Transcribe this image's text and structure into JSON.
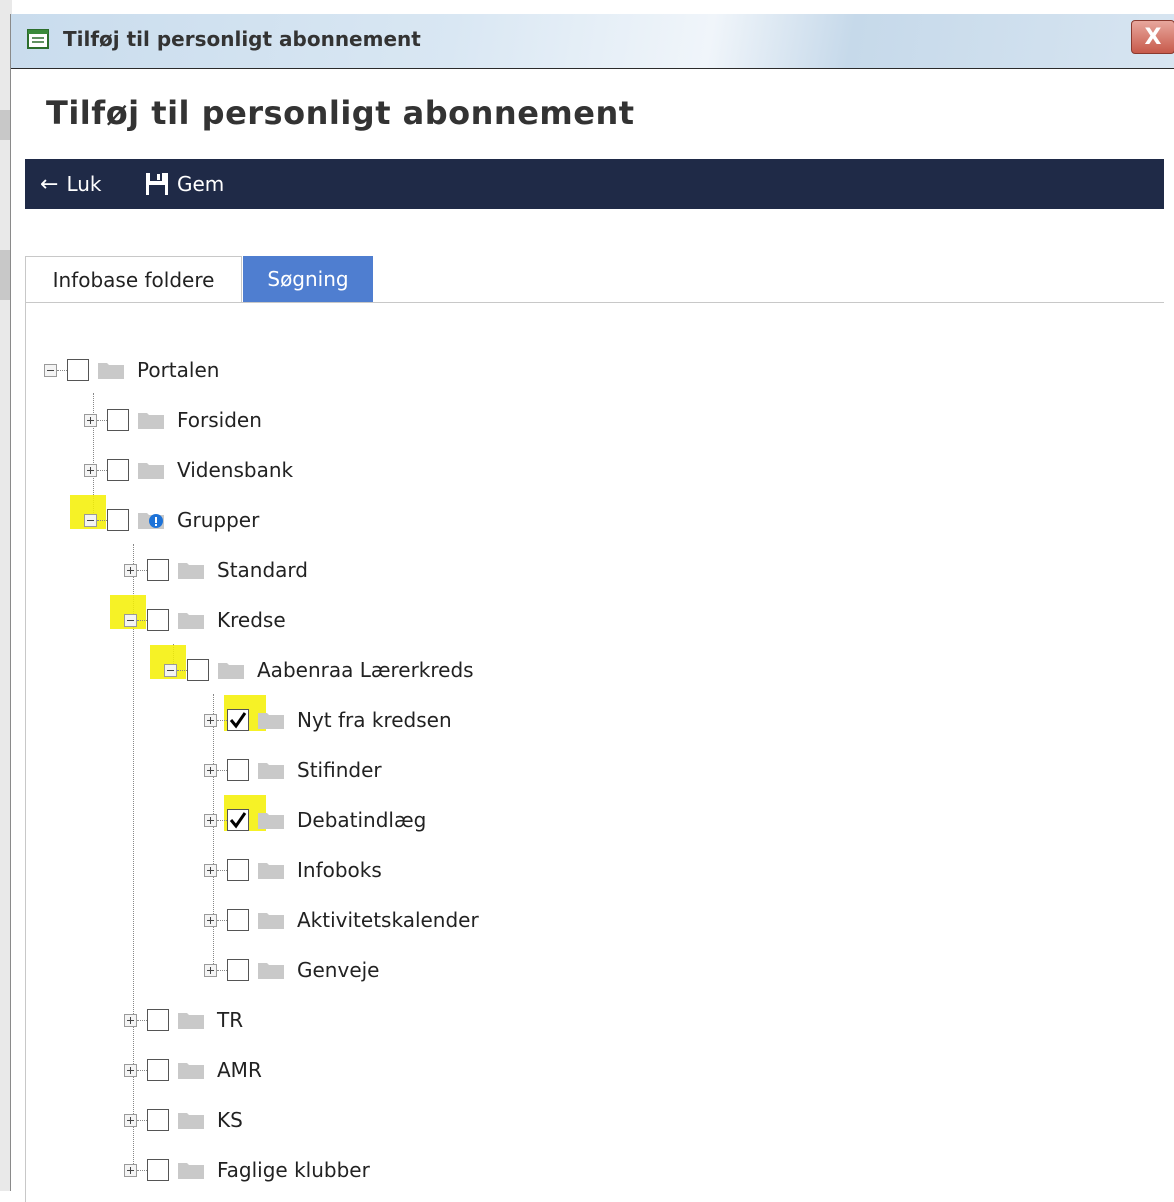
{
  "window": {
    "title": "Tilføj til personligt abonnement",
    "close_glyph": "X"
  },
  "page": {
    "title": "Tilføj til personligt abonnement"
  },
  "toolbar": {
    "close_label": "Luk",
    "close_icon": "arrow-left-icon",
    "save_label": "Gem",
    "save_icon": "floppy-disk-icon"
  },
  "tabs": [
    {
      "label": "Infobase foldere",
      "active": true
    },
    {
      "label": "Søgning",
      "active": false
    }
  ],
  "tree": {
    "items": [
      {
        "label": "Portalen",
        "level": 0,
        "expanded": true,
        "checked": false
      },
      {
        "label": "Forsiden",
        "level": 1,
        "expanded": false,
        "checked": false
      },
      {
        "label": "Vidensbank",
        "level": 1,
        "expanded": false,
        "checked": false
      },
      {
        "label": "Grupper",
        "level": 1,
        "expanded": true,
        "checked": false,
        "highlighted": true,
        "info_badge": true
      },
      {
        "label": "Standard",
        "level": 2,
        "expanded": false,
        "checked": false
      },
      {
        "label": "Kredse",
        "level": 2,
        "expanded": true,
        "checked": false,
        "highlighted": true
      },
      {
        "label": "Aabenraa Lærerkreds",
        "level": 3,
        "expanded": true,
        "checked": false,
        "highlighted": true
      },
      {
        "label": "Nyt fra kredsen",
        "level": 4,
        "expanded": false,
        "checked": true,
        "highlighted": true
      },
      {
        "label": "Stifinder",
        "level": 4,
        "expanded": false,
        "checked": false
      },
      {
        "label": "Debatindlæg",
        "level": 4,
        "expanded": false,
        "checked": true,
        "highlighted": true
      },
      {
        "label": "Infoboks",
        "level": 4,
        "expanded": false,
        "checked": false
      },
      {
        "label": "Aktivitetskalender",
        "level": 4,
        "expanded": false,
        "checked": false
      },
      {
        "label": "Genveje",
        "level": 4,
        "expanded": false,
        "checked": false
      },
      {
        "label": "TR",
        "level": 2,
        "expanded": false,
        "checked": false
      },
      {
        "label": "AMR",
        "level": 2,
        "expanded": false,
        "checked": false
      },
      {
        "label": "KS",
        "level": 2,
        "expanded": false,
        "checked": false
      },
      {
        "label": "Faglige klubber",
        "level": 2,
        "expanded": false,
        "checked": false
      }
    ]
  },
  "colors": {
    "toolbar_bg": "#1f2a47",
    "tab_inactive_bg": "#4f7ed0",
    "highlight": "#f5f000"
  }
}
